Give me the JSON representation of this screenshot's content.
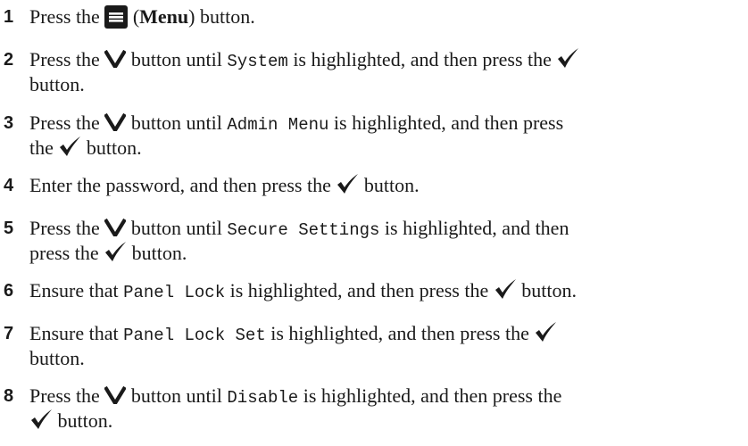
{
  "steps": [
    {
      "num": "1",
      "parts": [
        {
          "t": "text",
          "v": "Press the "
        },
        {
          "t": "icon",
          "icon": "menu-icon"
        },
        {
          "t": "text",
          "v": " ("
        },
        {
          "t": "bold",
          "v": "Menu"
        },
        {
          "t": "text",
          "v": ") button."
        }
      ]
    },
    {
      "num": "2",
      "parts": [
        {
          "t": "text",
          "v": "Press the "
        },
        {
          "t": "icon",
          "icon": "down-arrow-icon"
        },
        {
          "t": "text",
          "v": " button until "
        },
        {
          "t": "mono",
          "v": "System"
        },
        {
          "t": "text",
          "v": " is highlighted, and then press the "
        },
        {
          "t": "icon",
          "icon": "check-icon"
        },
        {
          "t": "br"
        },
        {
          "t": "text",
          "v": "button."
        }
      ]
    },
    {
      "num": "3",
      "parts": [
        {
          "t": "text",
          "v": "Press the "
        },
        {
          "t": "icon",
          "icon": "down-arrow-icon"
        },
        {
          "t": "text",
          "v": " button until "
        },
        {
          "t": "mono",
          "v": "Admin Menu"
        },
        {
          "t": "text",
          "v": " is highlighted, and then press"
        },
        {
          "t": "br"
        },
        {
          "t": "text",
          "v": "the "
        },
        {
          "t": "icon",
          "icon": "check-icon"
        },
        {
          "t": "text",
          "v": " button."
        }
      ]
    },
    {
      "num": "4",
      "parts": [
        {
          "t": "text",
          "v": "Enter the password, and then press the "
        },
        {
          "t": "icon",
          "icon": "check-icon"
        },
        {
          "t": "text",
          "v": " button."
        }
      ]
    },
    {
      "num": "5",
      "parts": [
        {
          "t": "text",
          "v": "Press the "
        },
        {
          "t": "icon",
          "icon": "down-arrow-icon"
        },
        {
          "t": "text",
          "v": " button until "
        },
        {
          "t": "mono",
          "v": "Secure Settings"
        },
        {
          "t": "text",
          "v": " is highlighted, and then"
        },
        {
          "t": "br"
        },
        {
          "t": "text",
          "v": "press the "
        },
        {
          "t": "icon",
          "icon": "check-icon"
        },
        {
          "t": "text",
          "v": " button."
        }
      ]
    },
    {
      "num": "6",
      "parts": [
        {
          "t": "text",
          "v": "Ensure that "
        },
        {
          "t": "mono",
          "v": "Panel Lock"
        },
        {
          "t": "text",
          "v": " is highlighted, and then press the "
        },
        {
          "t": "icon",
          "icon": "check-icon"
        },
        {
          "t": "text",
          "v": " button."
        }
      ]
    },
    {
      "num": "7",
      "parts": [
        {
          "t": "text",
          "v": "Ensure that "
        },
        {
          "t": "mono",
          "v": "Panel Lock Set"
        },
        {
          "t": "text",
          "v": " is highlighted, and then press the "
        },
        {
          "t": "icon",
          "icon": "check-icon"
        },
        {
          "t": "br"
        },
        {
          "t": "text",
          "v": "button."
        }
      ]
    },
    {
      "num": "8",
      "parts": [
        {
          "t": "text",
          "v": "Press the "
        },
        {
          "t": "icon",
          "icon": "down-arrow-icon"
        },
        {
          "t": "text",
          "v": " button until "
        },
        {
          "t": "mono",
          "v": "Disable"
        },
        {
          "t": "text",
          "v": " is highlighted, and then press the"
        },
        {
          "t": "br"
        },
        {
          "t": "icon",
          "icon": "check-icon"
        },
        {
          "t": "text",
          "v": " button."
        }
      ]
    }
  ]
}
